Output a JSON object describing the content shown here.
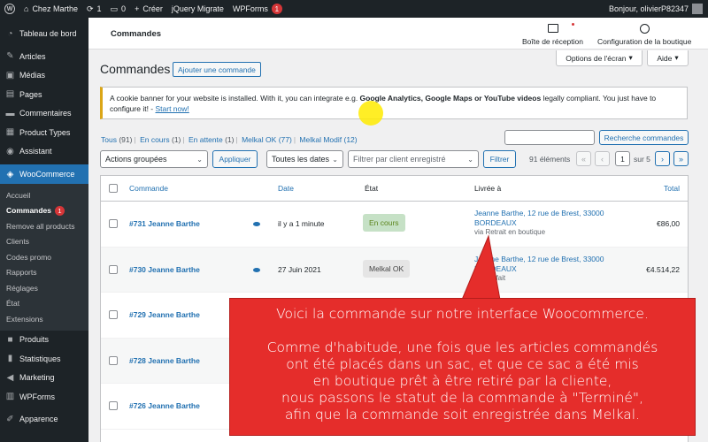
{
  "admin_bar": {
    "site_name": "Chez Marthe",
    "updates_count": "1",
    "comments_count": "0",
    "new_label": "Créer",
    "jquery_label": "jQuery Migrate",
    "wpforms_label": "WPForms",
    "wpforms_badge": "1",
    "greeting": "Bonjour, olivierP82347"
  },
  "sidebar": {
    "items": [
      {
        "label": "Tableau de bord",
        "icon": "dashboard-icon"
      },
      {
        "label": "Articles",
        "icon": "pin-icon"
      },
      {
        "label": "Médias",
        "icon": "media-icon"
      },
      {
        "label": "Pages",
        "icon": "page-icon"
      },
      {
        "label": "Commentaires",
        "icon": "comment-icon"
      },
      {
        "label": "Product Types",
        "icon": "grid-icon"
      },
      {
        "label": "Assistant",
        "icon": "chat-icon"
      },
      {
        "label": "WooCommerce",
        "icon": "woo-icon"
      }
    ],
    "submenu": [
      {
        "label": "Accueil"
      },
      {
        "label": "Commandes",
        "badge": "1"
      },
      {
        "label": "Remove all products"
      },
      {
        "label": "Clients"
      },
      {
        "label": "Codes promo"
      },
      {
        "label": "Rapports"
      },
      {
        "label": "Réglages"
      },
      {
        "label": "État"
      },
      {
        "label": "Extensions"
      }
    ],
    "items_after": [
      {
        "label": "Produits",
        "icon": "box-icon"
      },
      {
        "label": "Statistiques",
        "icon": "chart-icon"
      },
      {
        "label": "Marketing",
        "icon": "megaphone-icon"
      },
      {
        "label": "WPForms",
        "icon": "form-icon"
      },
      {
        "label": "Apparence",
        "icon": "brush-icon"
      }
    ]
  },
  "wc_header": {
    "title": "Commandes",
    "inbox_label": "Boîte de réception",
    "setup_label": "Configuration de la boutique"
  },
  "screen_options": {
    "options_label": "Options de l'écran",
    "help_label": "Aide"
  },
  "page": {
    "title": "Commandes",
    "add_button": "Ajouter une commande"
  },
  "notice": {
    "text_1": "A cookie banner for your website is installed. With it, you can integrate e.g. ",
    "bold": "Google Analytics, Google Maps or YouTube videos",
    "text_2": " legally compliant. You just have to configure it! - ",
    "link": "Start now!"
  },
  "status_links": [
    {
      "label": "Tous",
      "count": "(91)"
    },
    {
      "label": "En cours",
      "count": "(1)"
    },
    {
      "label": "En attente",
      "count": "(1)"
    },
    {
      "label": "Melkal OK",
      "count": "(77)"
    },
    {
      "label": "Melkal Modif",
      "count": "(12)"
    }
  ],
  "search": {
    "button": "Recherche commandes"
  },
  "tablenav": {
    "bulk_actions": "Actions groupées",
    "apply": "Appliquer",
    "dates": "Toutes les dates",
    "client_placeholder": "Filtrer par client enregistré",
    "filter": "Filtrer",
    "items_count": "91 éléments",
    "first": "«",
    "prev": "‹",
    "current_page": "1",
    "of_pages": "sur 5",
    "next": "›",
    "last": "»"
  },
  "table": {
    "headers": {
      "order": "Commande",
      "date": "Date",
      "status": "État",
      "ship": "Livrée à",
      "total": "Total"
    },
    "rows": [
      {
        "order": "#731 Jeanne Barthe",
        "date": "il y a 1 minute",
        "status": "En cours",
        "status_type": "processing",
        "ship_1": "Jeanne Barthe, 12 rue de Brest, 33000",
        "ship_2": "BORDEAUX",
        "ship_sub": "via Retrait en boutique",
        "total": "€86,00"
      },
      {
        "order": "#730 Jeanne Barthe",
        "date": "27 Juin 2021",
        "status": "Melkal OK",
        "status_type": "completed",
        "ship_1": "Jeanne Barthe, 12 rue de Brest, 33000",
        "ship_2": "BORDEAUX",
        "ship_sub": "via Forfait",
        "total": "€4.514,22"
      },
      {
        "order": "#729 Jeanne Barthe",
        "date": "",
        "status": "",
        "status_type": "",
        "ship_1": "",
        "ship_2": "",
        "ship_sub": "",
        "total": ""
      },
      {
        "order": "#728 Jeanne Barthe",
        "date": "",
        "status": "",
        "status_type": "",
        "ship_1": "",
        "ship_2": "",
        "ship_sub": "",
        "total": ""
      },
      {
        "order": "#726 Jeanne Barthe",
        "date": "",
        "status": "",
        "status_type": "",
        "ship_1": "",
        "ship_2": "",
        "ship_sub": "",
        "total": ""
      }
    ]
  },
  "callout": {
    "lines": [
      "Voici la commande sur notre interface Woocommerce.",
      "",
      "Comme d'habitude, une fois que les articles commandés",
      "ont été placés dans un sac, et que ce sac a été mis",
      "en boutique prêt à être retiré par la cliente,",
      "nous passons le statut de la commande à \"Terminé\",",
      "afin que la commande soit enregistrée dans Melkal."
    ]
  },
  "colors": {
    "wp_blue": "#2271b1",
    "admin_dark": "#1d2327",
    "callout_red": "#e52d2b",
    "processing_bg": "#c6e1c6",
    "notice_border": "#dba617"
  }
}
